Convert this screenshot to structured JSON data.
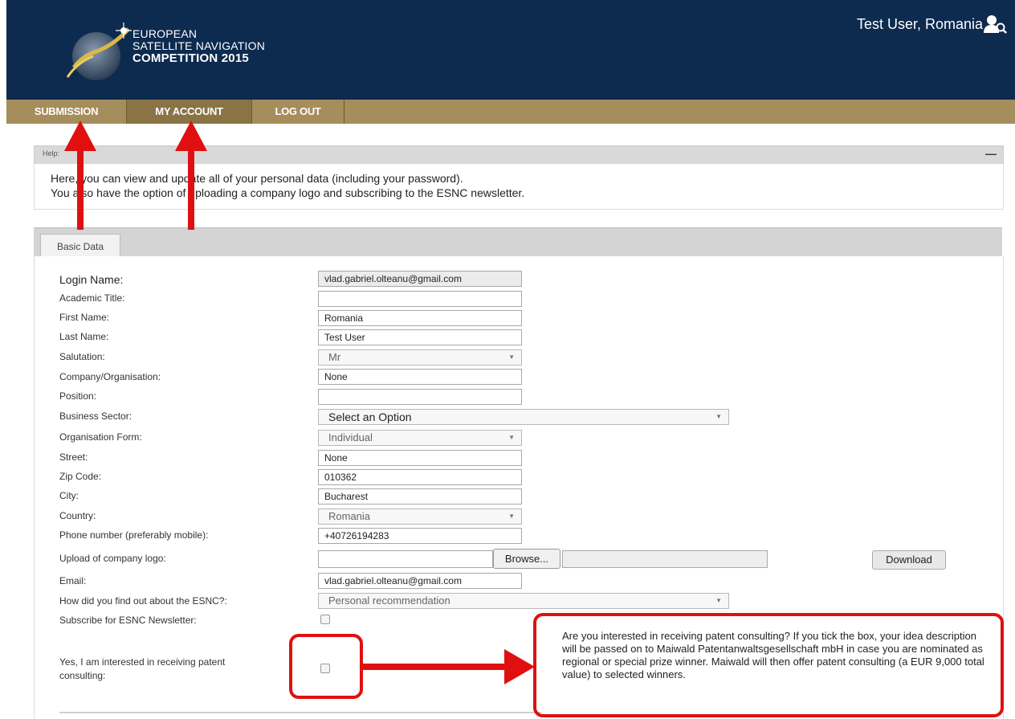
{
  "header": {
    "logo_line1": "EUROPEAN",
    "logo_line2": "SATELLITE NAVIGATION",
    "logo_line3": "COMPETITION 2015",
    "user": "Test User, Romania",
    "user_icon": "user-search-icon"
  },
  "nav": {
    "items": [
      {
        "label": "SUBMISSION"
      },
      {
        "label": "MY ACCOUNT"
      },
      {
        "label": "LOG OUT"
      }
    ]
  },
  "help": {
    "title": "Help:",
    "minimize": "—",
    "line1": "Here, you can view and update all of your personal data (including your password).",
    "line2": "You also have the option of uploading a company logo and subscribing to the ESNC newsletter."
  },
  "tabs": {
    "basic": "Basic Data"
  },
  "form": {
    "login_name": {
      "label": "Login Name:",
      "value": "vlad.gabriel.olteanu@gmail.com"
    },
    "academic_title": {
      "label": "Academic Title:",
      "value": ""
    },
    "first_name": {
      "label": "First Name:",
      "value": "Romania"
    },
    "last_name": {
      "label": "Last Name:",
      "value": "Test User"
    },
    "salutation": {
      "label": "Salutation:",
      "value": "Mr"
    },
    "company": {
      "label": "Company/Organisation:",
      "value": "None"
    },
    "position": {
      "label": "Position:",
      "value": ""
    },
    "business_sector": {
      "label": "Business Sector:",
      "value": "Select an Option"
    },
    "organisation_form": {
      "label": "Organisation Form:",
      "value": "Individual"
    },
    "street": {
      "label": "Street:",
      "value": "None"
    },
    "zip": {
      "label": "Zip Code:",
      "value": "010362"
    },
    "city": {
      "label": "City:",
      "value": "Bucharest"
    },
    "country": {
      "label": "Country:",
      "value": "Romania"
    },
    "phone": {
      "label": "Phone number (preferably mobile):",
      "value": "+40726194283"
    },
    "logo_upload": {
      "label": "Upload of company logo:",
      "browse": "Browse...",
      "download": "Download"
    },
    "email": {
      "label": "Email:",
      "value": "vlad.gabriel.olteanu@gmail.com"
    },
    "found_out": {
      "label": "How did you find out about the ESNC?:",
      "value": "Personal recommendation"
    },
    "newsletter": {
      "label": "Subscribe for ESNC Newsletter:"
    },
    "patent": {
      "label_line1": "Yes, I am interested in receiving patent",
      "label_line2": "consulting:"
    }
  },
  "callout": {
    "text": "Are you interested in receiving patent consulting? If you tick the box, your idea description will be passed on to Maiwald Patentanwaltsgesellschaft mbH in case you are nominated as regional or special prize winner. Maiwald will then offer patent consulting (a EUR 9,000 total value) to selected winners."
  },
  "colors": {
    "header_bg": "#0d2a4f",
    "nav_bg": "#a58d5c",
    "annotation_red": "#e01010"
  }
}
